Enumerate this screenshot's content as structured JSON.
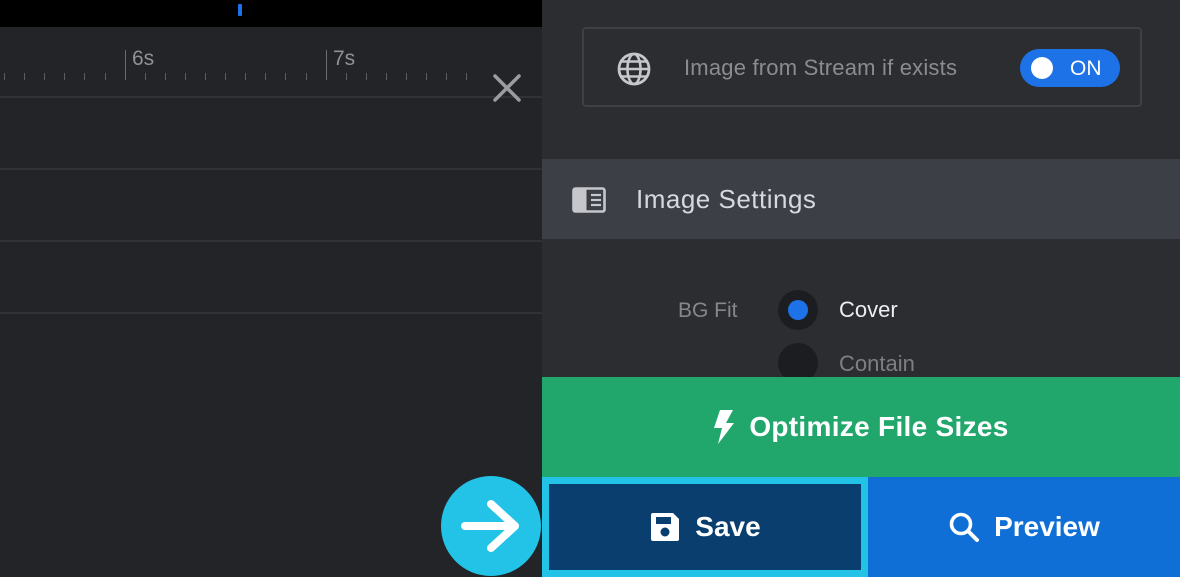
{
  "timeline": {
    "ruler_labels": [
      "6s",
      "7s"
    ]
  },
  "stream": {
    "label": "Image from Stream if exists",
    "toggle_state": "ON",
    "icon": "globe-icon"
  },
  "image_settings": {
    "title": "Image Settings",
    "icon": "panel-layout-icon",
    "bg_fit": {
      "label": "BG Fit",
      "options": [
        {
          "label": "Cover",
          "selected": true
        },
        {
          "label": "Contain",
          "selected": false
        }
      ]
    }
  },
  "actions": {
    "optimize_label": "Optimize File Sizes",
    "save_label": "Save",
    "preview_label": "Preview"
  },
  "colors": {
    "accent_blue": "#1d72e8",
    "optimize_green": "#21a66c",
    "save_bg": "#0a3e6f",
    "highlight_cyan": "#22c3e6",
    "preview_blue": "#0f6fd6"
  }
}
